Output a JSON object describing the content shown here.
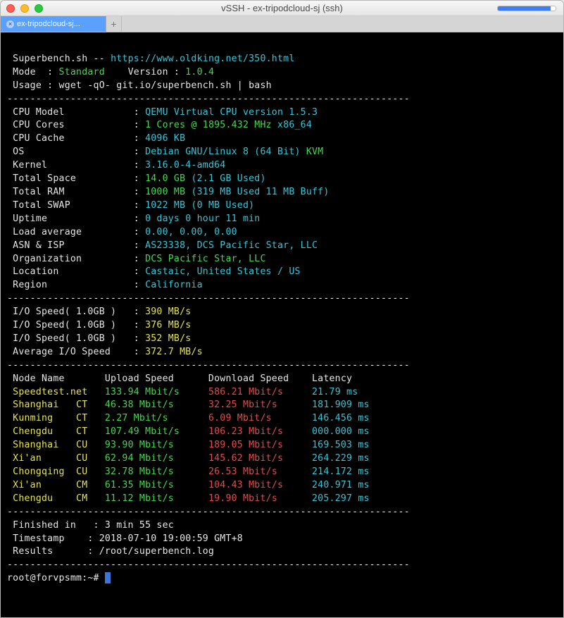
{
  "window": {
    "title": "vSSH - ex-tripodcloud-sj (ssh)",
    "tab_label": "ex-tripodcloud-sj...",
    "progress_pct": 92
  },
  "header": {
    "line1_a": "Superbench.sh -- ",
    "line1_b": "https://www.oldking.net/350.html",
    "mode_label": " Mode  : ",
    "mode_value": "Standard",
    "version_label": "    Version : ",
    "version_value": "1.0.4",
    "usage": " Usage : wget -qO- git.io/superbench.sh | bash"
  },
  "dash": "----------------------------------------------------------------------",
  "sys": [
    {
      "k": " CPU Model            ",
      "v1": "QEMU Virtual CPU version 1.5.3",
      "v1c": "c"
    },
    {
      "k": " CPU Cores            ",
      "v1": "1 Cores @ 1895.432 MHz",
      "v1c": "g",
      "v2": " x86_64",
      "v2c": "c"
    },
    {
      "k": " CPU Cache            ",
      "v1": "4096 KB",
      "v1c": "c"
    },
    {
      "k": " OS                   ",
      "v1": "Debian GNU/Linux 8 (64 Bit)",
      "v1c": "c",
      "v2": " KVM",
      "v2c": "g"
    },
    {
      "k": " Kernel               ",
      "v1": "3.16.0-4-amd64",
      "v1c": "c"
    },
    {
      "k": " Total Space          ",
      "v1": "14.0 GB ",
      "v1c": "g",
      "v2": "(2.1 GB Used)",
      "v2c": "c"
    },
    {
      "k": " Total RAM            ",
      "v1": "1000 MB ",
      "v1c": "g",
      "v2": "(319 MB Used 11 MB Buff)",
      "v2c": "c"
    },
    {
      "k": " Total SWAP           ",
      "v1": "1022 MB (0 MB Used)",
      "v1c": "c"
    },
    {
      "k": " Uptime               ",
      "v1": "0 days 0 hour 11 min",
      "v1c": "c"
    },
    {
      "k": " Load average         ",
      "v1": "0.00, 0.00, 0.00",
      "v1c": "c"
    },
    {
      "k": " ASN & ISP            ",
      "v1": "AS23338, DCS Pacific Star, LLC",
      "v1c": "c"
    },
    {
      "k": " Organization         ",
      "v1": "DCS Pacific Star, LLC",
      "v1c": "g"
    },
    {
      "k": " Location             ",
      "v1": "Castaic, United States / US",
      "v1c": "c"
    },
    {
      "k": " Region               ",
      "v1": "California",
      "v1c": "c"
    }
  ],
  "io": [
    {
      "k": " I/O Speed( 1.0GB )   ",
      "v": "390 MB/s"
    },
    {
      "k": " I/O Speed( 1.0GB )   ",
      "v": "376 MB/s"
    },
    {
      "k": " I/O Speed( 1.0GB )   ",
      "v": "352 MB/s"
    },
    {
      "k": " Average I/O Speed    ",
      "v": "372.7 MB/s"
    }
  ],
  "speed_header": {
    "node": " Node Name       ",
    "up": "Upload Speed      ",
    "dn": "Download Speed    ",
    "lat": "Latency   "
  },
  "speed": [
    {
      "node": " Speedtest.net   ",
      "up": "133.94 Mbit/s     ",
      "dn": "586.21 Mbit/s     ",
      "lat": "21.79 ms"
    },
    {
      "node": " Shanghai   CT   ",
      "up": "46.38 Mbit/s      ",
      "dn": "32.25 Mbit/s      ",
      "lat": "181.909 ms"
    },
    {
      "node": " Kunming    CT   ",
      "up": "2.27 Mbit/s       ",
      "dn": "6.09 Mbit/s       ",
      "lat": "146.456 ms"
    },
    {
      "node": " Chengdu    CT   ",
      "up": "107.49 Mbit/s     ",
      "dn": "106.23 Mbit/s     ",
      "lat": "000.000 ms"
    },
    {
      "node": " Shanghai   CU   ",
      "up": "93.90 Mbit/s      ",
      "dn": "189.05 Mbit/s     ",
      "lat": "169.503 ms"
    },
    {
      "node": " Xi'an      CU   ",
      "up": "62.94 Mbit/s      ",
      "dn": "145.62 Mbit/s     ",
      "lat": "264.229 ms"
    },
    {
      "node": " Chongqing  CU   ",
      "up": "32.78 Mbit/s      ",
      "dn": "26.53 Mbit/s      ",
      "lat": "214.172 ms"
    },
    {
      "node": " Xi'an      CM   ",
      "up": "61.35 Mbit/s      ",
      "dn": "104.43 Mbit/s     ",
      "lat": "240.971 ms"
    },
    {
      "node": " Chengdu    CM   ",
      "up": "11.12 Mbit/s      ",
      "dn": "19.90 Mbit/s      ",
      "lat": "205.297 ms"
    }
  ],
  "footer": {
    "finished_k": " Finished in   : ",
    "finished_v": "3 min 55 sec",
    "ts_k": " Timestamp    : ",
    "ts_v": "2018-07-10 19:00:59 GMT+8",
    "res_k": " Results      : ",
    "res_v": "/root/superbench.log"
  },
  "prompt": "root@forvpsmm:~# "
}
